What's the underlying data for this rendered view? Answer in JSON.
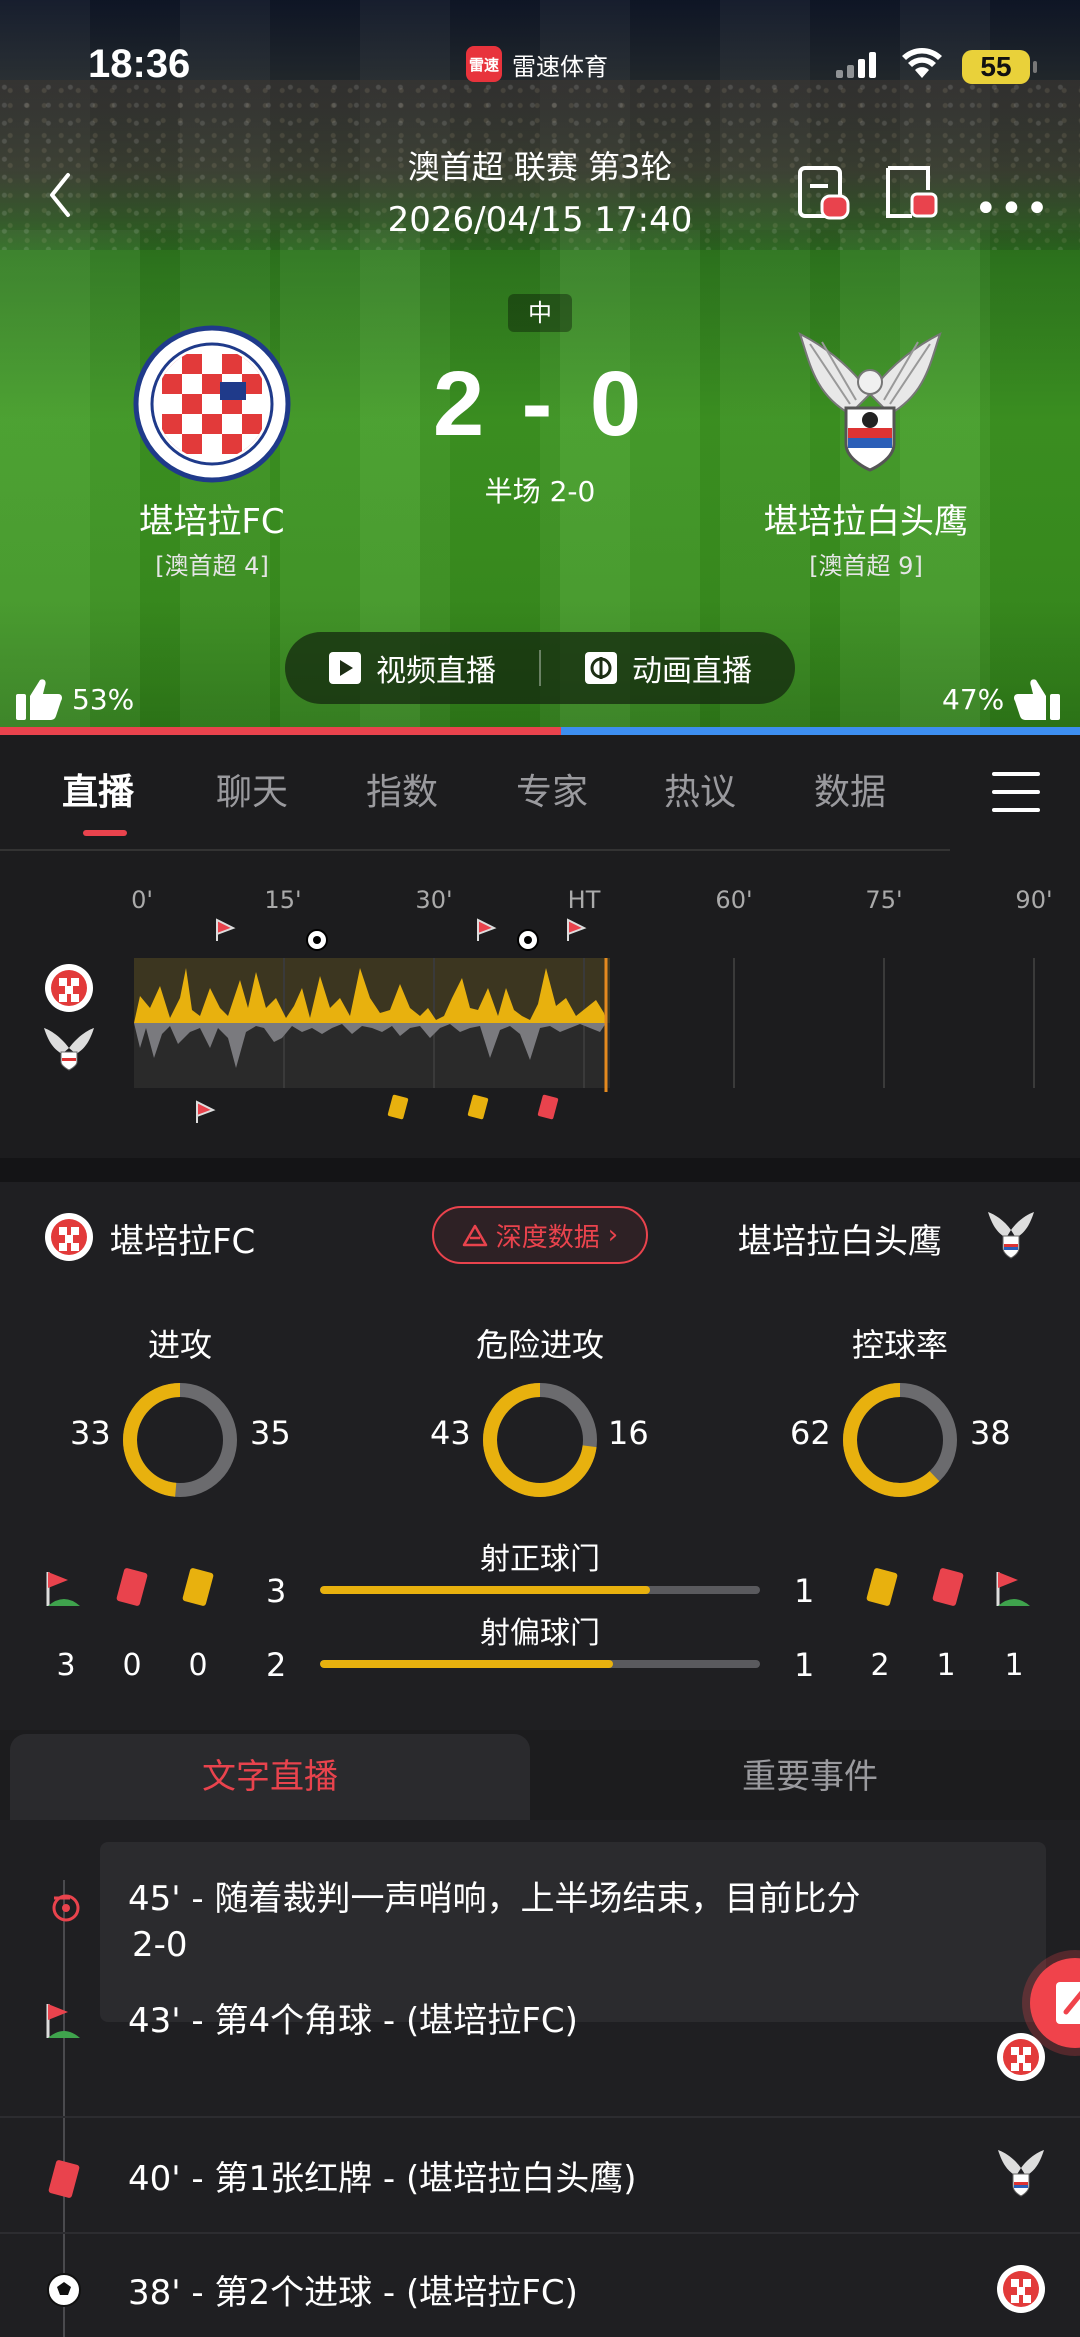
{
  "status_bar": {
    "time": "18:36",
    "app_name": "雷速体育",
    "app_logo_text": "雷速",
    "battery": "55"
  },
  "match": {
    "league_round": "澳首超 联赛 第3轮",
    "datetime": "2026/04/15 17:40",
    "status_tag": "中",
    "score": "2 - 0",
    "half_score": "半场 2-0",
    "home": {
      "name": "堪培拉FC",
      "rank": "[澳首超 4]"
    },
    "away": {
      "name": "堪培拉白头鹰",
      "rank": "[澳首超 9]"
    },
    "video_live_label": "视频直播",
    "anim_live_label": "动画直播",
    "home_like_pct": "53%",
    "away_like_pct": "47%",
    "home_vote_fraction": 0.53
  },
  "tabs": [
    "直播",
    "聊天",
    "指数",
    "专家",
    "热议",
    "数据"
  ],
  "timeline": {
    "ticks": [
      "0'",
      "15'",
      "30'",
      "HT",
      "60'",
      "75'",
      "90'"
    ],
    "current_minute": 45
  },
  "stats": {
    "home_name": "堪培拉FC",
    "away_name": "堪培拉白头鹰",
    "deep_data_label": "深度数据",
    "gauges": [
      {
        "title": "进攻",
        "home": "33",
        "away": "35"
      },
      {
        "title": "危险进攻",
        "home": "43",
        "away": "16"
      },
      {
        "title": "控球率",
        "home": "62",
        "away": "38"
      }
    ],
    "shots_on": {
      "title": "射正球门",
      "home": "3",
      "away": "1"
    },
    "shots_off": {
      "title": "射偏球门",
      "home": "2",
      "away": "1"
    },
    "home_counts": {
      "corners": "3",
      "red": "0",
      "yellow": "0"
    },
    "away_counts": {
      "yellow": "2",
      "red": "1",
      "corners": "1"
    },
    "colors": {
      "home": "#e8b10e",
      "away": "#6b6b6e",
      "red": "#e9434d"
    }
  },
  "sub_tabs": {
    "active": "文字直播",
    "other": "重要事件"
  },
  "feed": [
    {
      "text_line1": "45' - 随着裁判一声哨响，上半场结束，目前比分",
      "text_line2": "2-0",
      "icon": "whistle-icon"
    },
    {
      "text": "43' - 第4个角球 - (堪培拉FC)",
      "icon": "corner-flag-icon"
    },
    {
      "text": "40' - 第1张红牌 - (堪培拉白头鹰)",
      "icon": "red-card-icon"
    },
    {
      "text": "38' - 第2个进球 - (堪培拉FC)",
      "icon": "ball-icon"
    }
  ]
}
